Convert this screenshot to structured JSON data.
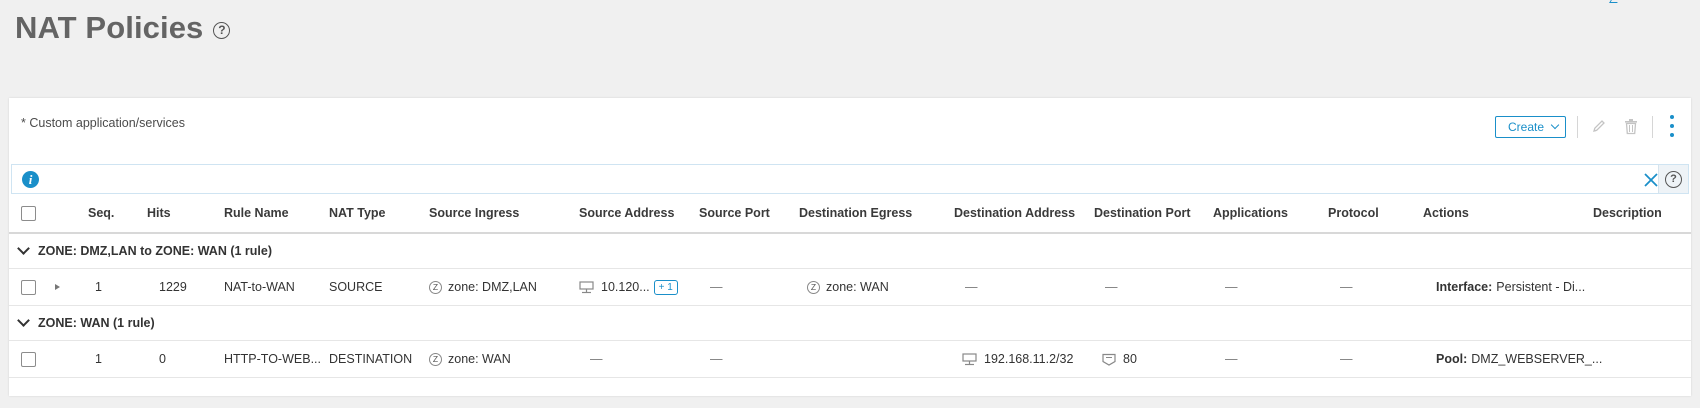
{
  "page": {
    "title": "NAT Policies",
    "help_icon_glyph": "?"
  },
  "toolbar": {
    "note": "* Custom application/services",
    "create_label": "Create"
  },
  "colors": {
    "accent": "#1a8fc9",
    "title": "#646464",
    "background": "#f0f0f0"
  },
  "info_bar": {
    "info_glyph": "i",
    "help_glyph": "?"
  },
  "table": {
    "columns": [
      "Seq.",
      "Hits",
      "Rule Name",
      "NAT Type",
      "Source Ingress",
      "Source Address",
      "Source Port",
      "Destination Egress",
      "Destination Address",
      "Destination Port",
      "Applications",
      "Protocol",
      "Actions",
      "Description"
    ],
    "groups": [
      {
        "title": "ZONE: DMZ,LAN to ZONE: WAN (1 rule)",
        "rows": [
          {
            "seq": "1",
            "hits": "1229",
            "rule_name": "NAT-to-WAN",
            "nat_type": "SOURCE",
            "zone_glyph": "Z",
            "source_ingress": "zone: DMZ,LAN",
            "source_address": "10.120...",
            "source_address_extra": "+ 1",
            "source_port": "—",
            "destination_egress": "zone: WAN",
            "destination_address": "—",
            "destination_port": "—",
            "applications": "—",
            "protocol": "—",
            "action_label": "Interface:",
            "action_value": "Persistent - Di...",
            "description": ""
          }
        ]
      },
      {
        "title": "ZONE: WAN (1 rule)",
        "rows": [
          {
            "seq": "1",
            "hits": "0",
            "rule_name": "HTTP-TO-WEB...",
            "nat_type": "DESTINATION",
            "zone_glyph": "Z",
            "source_ingress": "zone: WAN",
            "source_address": "—",
            "source_port": "—",
            "destination_egress": "",
            "destination_address": "192.168.11.2/32",
            "destination_port": "80",
            "applications": "—",
            "protocol": "—",
            "action_label": "Pool:",
            "action_value": "DMZ_WEBSERVER_...",
            "description": ""
          }
        ]
      }
    ]
  }
}
